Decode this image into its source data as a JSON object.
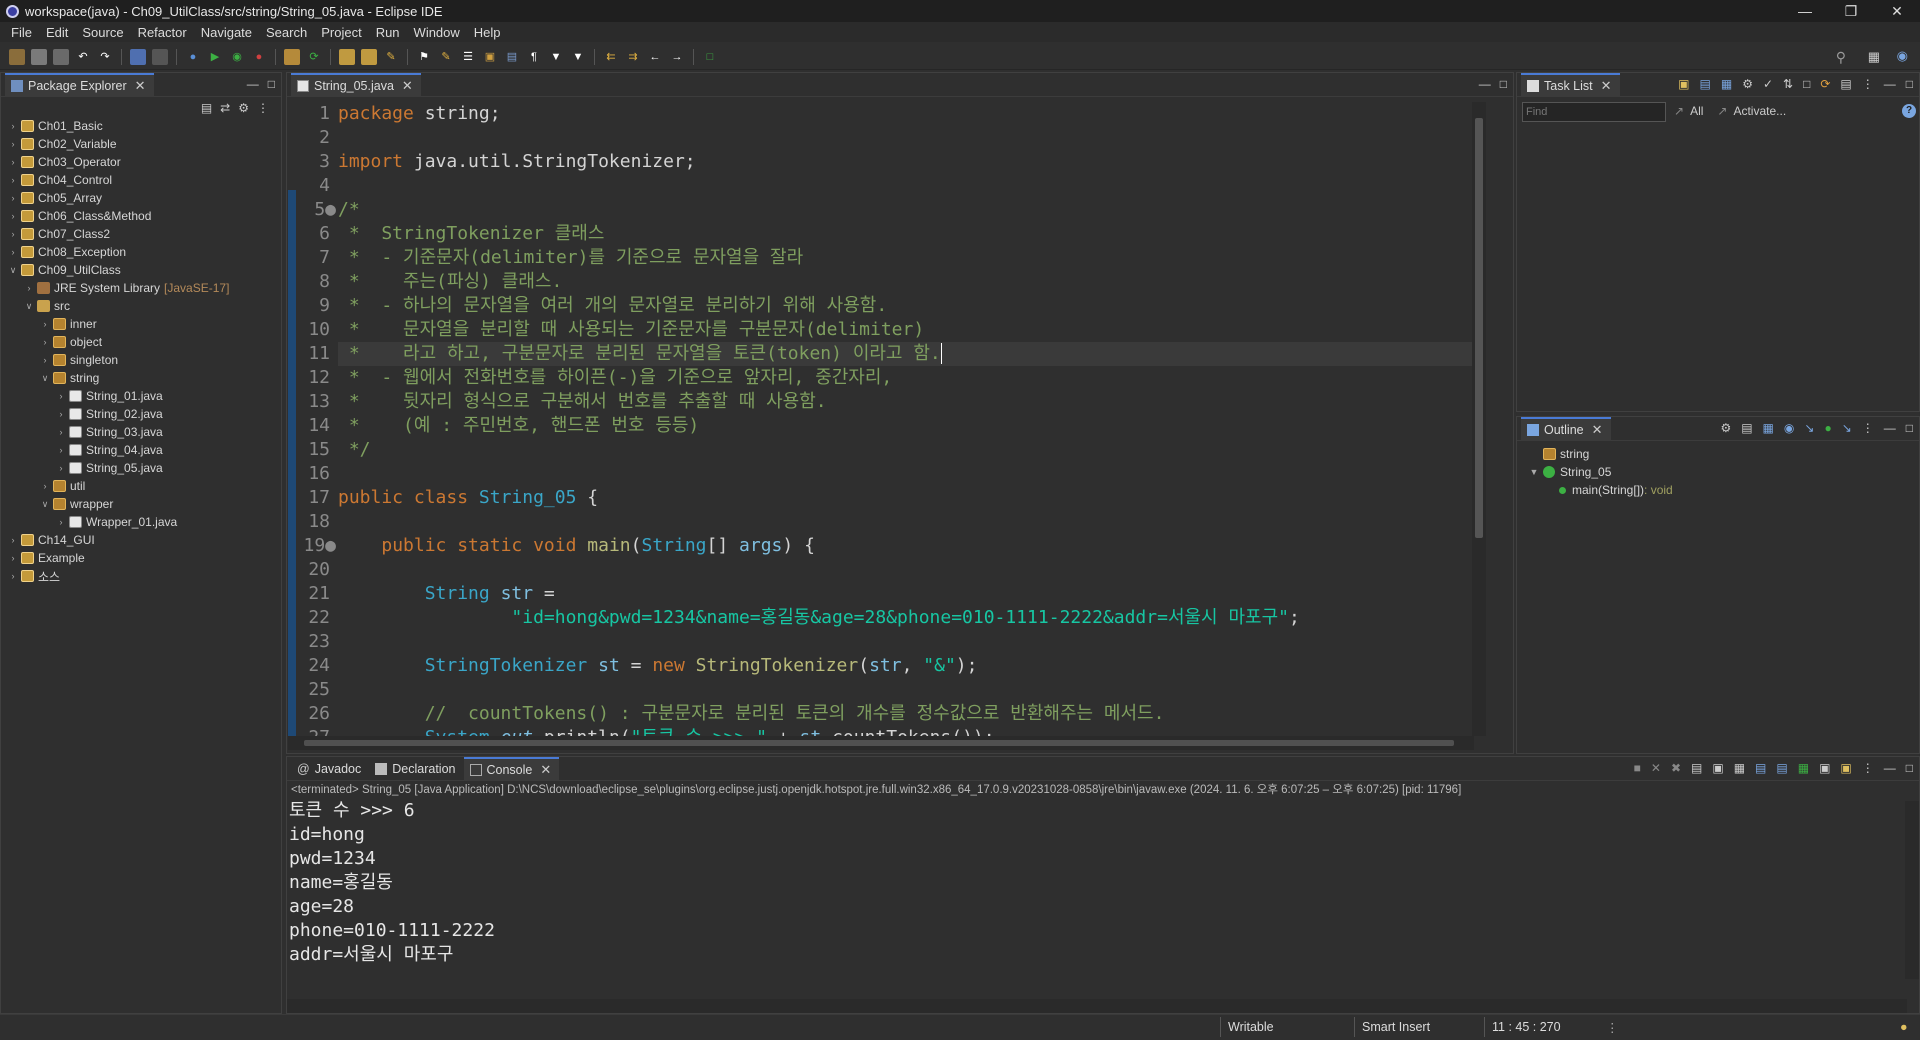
{
  "window": {
    "title": "workspace(java) - Ch09_UtilClass/src/string/String_05.java - Eclipse IDE"
  },
  "menu": [
    "File",
    "Edit",
    "Source",
    "Refactor",
    "Navigate",
    "Search",
    "Project",
    "Run",
    "Window",
    "Help"
  ],
  "package_explorer": {
    "tab": "Package Explorer",
    "items": [
      {
        "label": "Ch01_Basic",
        "depth": 0,
        "kind": "proj",
        "open": false
      },
      {
        "label": "Ch02_Variable",
        "depth": 0,
        "kind": "proj",
        "open": false
      },
      {
        "label": "Ch03_Operator",
        "depth": 0,
        "kind": "proj",
        "open": false
      },
      {
        "label": "Ch04_Control",
        "depth": 0,
        "kind": "proj",
        "open": false
      },
      {
        "label": "Ch05_Array",
        "depth": 0,
        "kind": "proj",
        "open": false
      },
      {
        "label": "Ch06_Class&Method",
        "depth": 0,
        "kind": "proj",
        "open": false
      },
      {
        "label": "Ch07_Class2",
        "depth": 0,
        "kind": "proj",
        "open": false
      },
      {
        "label": "Ch08_Exception",
        "depth": 0,
        "kind": "proj",
        "open": false
      },
      {
        "label": "Ch09_UtilClass",
        "depth": 0,
        "kind": "proj",
        "open": true
      },
      {
        "label": "JRE System Library",
        "decoration": "[JavaSE-17]",
        "depth": 1,
        "kind": "lib",
        "open": false
      },
      {
        "label": "src",
        "depth": 1,
        "kind": "src",
        "open": true
      },
      {
        "label": "inner",
        "depth": 2,
        "kind": "pkg",
        "open": false
      },
      {
        "label": "object",
        "depth": 2,
        "kind": "pkg",
        "open": false
      },
      {
        "label": "singleton",
        "depth": 2,
        "kind": "pkg",
        "open": false
      },
      {
        "label": "string",
        "depth": 2,
        "kind": "pkg",
        "open": true
      },
      {
        "label": "String_01.java",
        "depth": 3,
        "kind": "java",
        "open": false
      },
      {
        "label": "String_02.java",
        "depth": 3,
        "kind": "java",
        "open": false
      },
      {
        "label": "String_03.java",
        "depth": 3,
        "kind": "java",
        "open": false
      },
      {
        "label": "String_04.java",
        "depth": 3,
        "kind": "java",
        "open": false
      },
      {
        "label": "String_05.java",
        "depth": 3,
        "kind": "java",
        "open": false
      },
      {
        "label": "util",
        "depth": 2,
        "kind": "pkg",
        "open": false
      },
      {
        "label": "wrapper",
        "depth": 2,
        "kind": "pkg",
        "open": true
      },
      {
        "label": "Wrapper_01.java",
        "depth": 3,
        "kind": "java",
        "open": false
      },
      {
        "label": "Ch14_GUI",
        "depth": 0,
        "kind": "proj",
        "open": false
      },
      {
        "label": "Example",
        "depth": 0,
        "kind": "proj",
        "open": false
      },
      {
        "label": "소스",
        "depth": 0,
        "kind": "proj",
        "open": false
      }
    ]
  },
  "editor": {
    "tab": "String_05.java",
    "lines": [
      {
        "n": "1",
        "html": "<span class='kw'>package</span> string;"
      },
      {
        "n": "2",
        "html": ""
      },
      {
        "n": "3",
        "html": "<span class='kw'>import</span> java.util.StringTokenizer;"
      },
      {
        "n": "4",
        "html": ""
      },
      {
        "n": "5",
        "html": "<span class='cm'>/*</span>",
        "fold": true
      },
      {
        "n": "6",
        "html": "<span class='cm'> *  StringTokenizer 클래스</span>"
      },
      {
        "n": "7",
        "html": "<span class='cm'> *  - 기준문자(delimiter)를 기준으로 문자열을 잘라</span>"
      },
      {
        "n": "8",
        "html": "<span class='cm'> *    주는(파싱) 클래스.</span>"
      },
      {
        "n": "9",
        "html": "<span class='cm'> *  - 하나의 문자열을 여러 개의 문자열로 분리하기 위해 사용함.</span>"
      },
      {
        "n": "10",
        "html": "<span class='cm'> *    문자열을 분리할 때 사용되는 기준문자를 구분문자(delimiter)</span>"
      },
      {
        "n": "11",
        "html": "<span class='cm'> *    라고 하고, 구분문자로 분리된 문자열을 토큰(token) 이라고 함.</span>",
        "current": true
      },
      {
        "n": "12",
        "html": "<span class='cm'> *  - 웹에서 전화번호를 하이픈(-)을 기준으로 앞자리, 중간자리,</span>"
      },
      {
        "n": "13",
        "html": "<span class='cm'> *    뒷자리 형식으로 구분해서 번호를 추출할 때 사용함.</span>"
      },
      {
        "n": "14",
        "html": "<span class='cm'> *    (예 : 주민번호, 핸드폰 번호 등등)</span>"
      },
      {
        "n": "15",
        "html": "<span class='cm'> */</span>"
      },
      {
        "n": "16",
        "html": ""
      },
      {
        "n": "17",
        "html": "<span class='kw'>public class</span> <span class='ty'>String_05</span> {"
      },
      {
        "n": "18",
        "html": ""
      },
      {
        "n": "19",
        "html": "    <span class='kw'>public static void</span> <span class='fn'>main</span>(<span class='ty'>String</span>[] <span class='va'>args</span>) {",
        "fold": true
      },
      {
        "n": "20",
        "html": ""
      },
      {
        "n": "21",
        "html": "        <span class='ty'>String</span> <span class='va'>str</span> ="
      },
      {
        "n": "22",
        "html": "                <span class='st'>\"id=hong&amp;pwd=1234&amp;name=홍길동&amp;age=28&amp;phone=010-1111-2222&amp;addr=서울시 마포구\"</span>;"
      },
      {
        "n": "23",
        "html": ""
      },
      {
        "n": "24",
        "html": "        <span class='ty'>StringTokenizer</span> <span class='va'>st</span> = <span class='kw'>new</span> <span class='fn'>StringTokenizer</span>(<span class='va'>str</span>, <span class='st'>\"&amp;\"</span>);"
      },
      {
        "n": "25",
        "html": ""
      },
      {
        "n": "26",
        "html": "        <span class='cm'>//  countTokens() : 구분문자로 분리된 토큰의 개수를 정수값으로 반환해주는 메서드.</span>"
      },
      {
        "n": "27",
        "html": "        <span class='ty'>System</span>.<span class='va'><i>out</i></span>.println(<span class='st'>\"토큰 수 >>> \"</span> + <span class='va'>st</span>.countTokens());"
      }
    ]
  },
  "task_list": {
    "tab": "Task List",
    "find_placeholder": "Find",
    "all": "All",
    "activate": "Activate..."
  },
  "outline": {
    "tab": "Outline",
    "items": [
      {
        "label": "string",
        "type": ""
      },
      {
        "label": "String_05",
        "type": ""
      },
      {
        "label": "main(String[])",
        "type": " : void"
      }
    ]
  },
  "bottom": {
    "tabs": [
      "Javadoc",
      "Declaration",
      "Console"
    ],
    "console_header": "<terminated> String_05 [Java Application] D:\\NCS\\download\\eclipse_se\\plugins\\org.eclipse.justj.openjdk.hotspot.jre.full.win32.x86_64_17.0.9.v20231028-0858\\jre\\bin\\javaw.exe  (2024. 11. 6. 오후 6:07:25 – 오후 6:07:25) [pid: 11796]",
    "output": [
      "토큰 수 >>> 6",
      "id=hong",
      "pwd=1234",
      "name=홍길동",
      "age=28",
      "phone=010-1111-2222",
      "addr=서울시 마포구"
    ]
  },
  "status": {
    "writable": "Writable",
    "insert_mode": "Smart Insert",
    "position": "11 : 45 : 270"
  },
  "colors": {
    "accent": "#4a7bd6",
    "keyword": "#cc7832",
    "comment": "#7f9f5f",
    "string": "#17c6a3",
    "type": "#3aa6c8"
  }
}
